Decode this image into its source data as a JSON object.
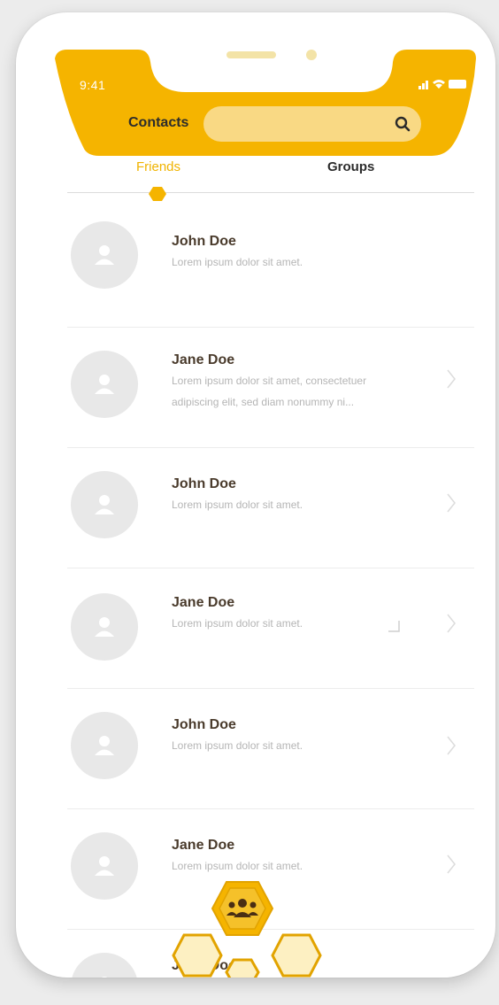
{
  "status_bar": {
    "time": "9:41"
  },
  "header": {
    "title": "Contacts",
    "search_placeholder": "",
    "search_icon": "search-icon"
  },
  "tabs": [
    {
      "label": "Friends",
      "active": true
    },
    {
      "label": "Groups",
      "active": false
    }
  ],
  "contacts": [
    {
      "name": "John Doe",
      "preview_line1": "Lorem ipsum dolor sit amet.",
      "preview_line2": ""
    },
    {
      "name": "Jane Doe",
      "preview_line1": "Lorem ipsum dolor sit amet, consectetuer",
      "preview_line2": "adipiscing elit, sed diam nonummy ni..."
    },
    {
      "name": "John Doe",
      "preview_line1": "Lorem ipsum dolor sit amet.",
      "preview_line2": ""
    },
    {
      "name": "Jane Doe",
      "preview_line1": "Lorem ipsum dolor sit amet.",
      "preview_line2": ""
    },
    {
      "name": "John Doe",
      "preview_line1": "Lorem ipsum dolor sit amet.",
      "preview_line2": ""
    },
    {
      "name": "Jane Doe",
      "preview_line1": "Lorem ipsum dolor sit amet.",
      "preview_line2": ""
    },
    {
      "name": "John Doe",
      "preview_line1": "",
      "preview_line2": ""
    }
  ],
  "colors": {
    "accent": "#f5b400",
    "accent_light": "#f9d984",
    "text_dark": "#4a3b2c",
    "text_muted": "#b5b5b5"
  },
  "icons": {
    "fab": "group-icon",
    "avatar": "user-icon",
    "chevron": "chevron-right-icon"
  }
}
